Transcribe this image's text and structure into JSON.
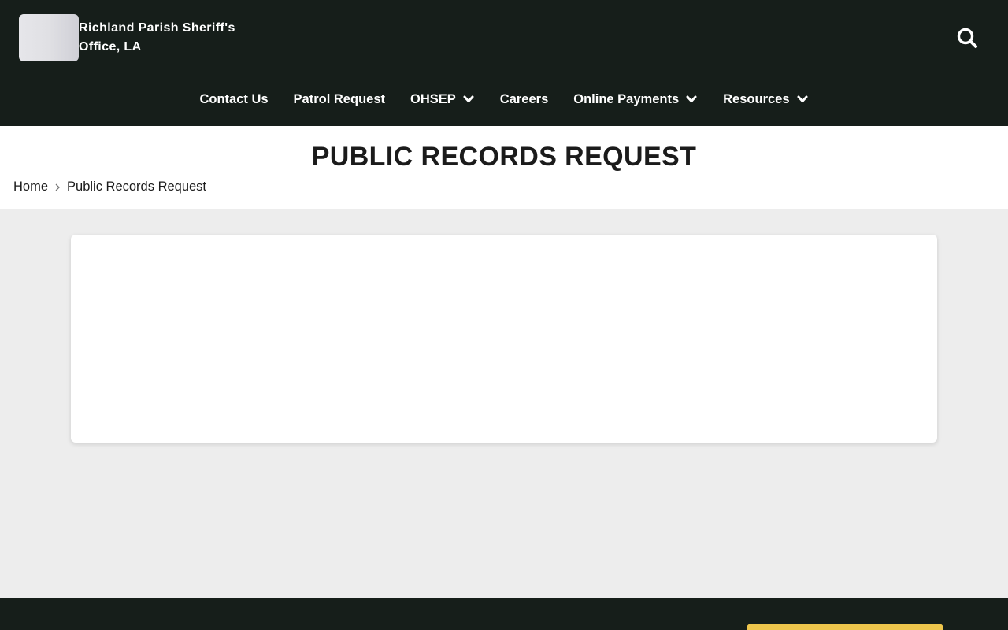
{
  "header": {
    "site_name": "Richland Parish Sheriff's Office, LA",
    "logo_icon": "sheriff-badge-logo",
    "search_icon": "search-icon",
    "colors": {
      "background": "#161e1a",
      "text": "#ffffff"
    }
  },
  "nav": {
    "items": [
      {
        "label": "Contact Us",
        "has_dropdown": false
      },
      {
        "label": "Patrol Request",
        "has_dropdown": false
      },
      {
        "label": "OHSEP",
        "has_dropdown": true
      },
      {
        "label": "Careers",
        "has_dropdown": false
      },
      {
        "label": "Online Payments",
        "has_dropdown": true
      },
      {
        "label": "Resources",
        "has_dropdown": true
      }
    ]
  },
  "page": {
    "title": "PUBLIC RECORDS REQUEST",
    "breadcrumb": [
      "Home",
      "Public Records Request"
    ]
  },
  "footer": {
    "accent_color": "#edc54c"
  }
}
